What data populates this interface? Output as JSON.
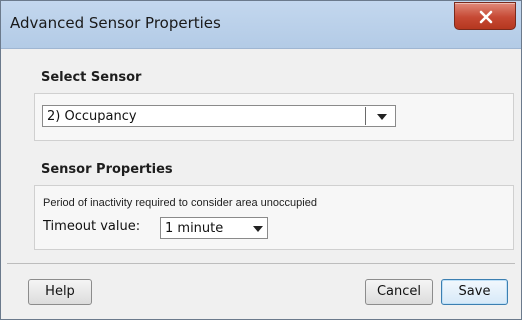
{
  "window": {
    "title": "Advanced Sensor Properties"
  },
  "select_sensor": {
    "heading": "Select Sensor",
    "selected": "2) Occupancy"
  },
  "sensor_properties": {
    "heading": "Sensor Properties",
    "description": "Period of inactivity required to consider area unoccupied",
    "timeout_label": "Timeout value:",
    "timeout_selected": "1 minute"
  },
  "buttons": {
    "help": "Help",
    "cancel": "Cancel",
    "save": "Save"
  },
  "icons": {
    "close": "close-icon",
    "dropdown": "chevron-down-icon"
  },
  "colors": {
    "title_bar": "#c3d7ee",
    "close_button": "#c64934",
    "primary_button_border": "#3c7fb1"
  }
}
